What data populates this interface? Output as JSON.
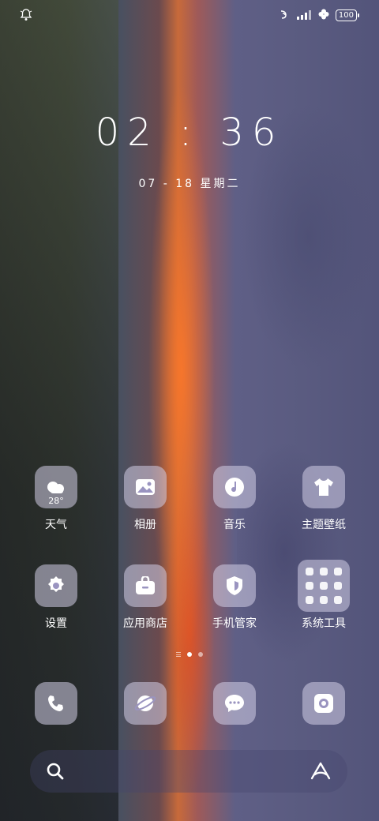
{
  "status": {
    "battery": "100",
    "icons_left": [
      "bell-icon"
    ],
    "icons_right": [
      "nfc-icon",
      "signal-icon",
      "fan-icon",
      "battery-icon"
    ]
  },
  "clock": {
    "time": "02 : 36",
    "date": "07 - 18 星期二"
  },
  "apps_row1": [
    {
      "label": "天气",
      "icon": "weather-icon",
      "extra": "28°"
    },
    {
      "label": "相册",
      "icon": "gallery-icon"
    },
    {
      "label": "音乐",
      "icon": "music-icon"
    },
    {
      "label": "主题壁纸",
      "icon": "theme-icon"
    }
  ],
  "apps_row2": [
    {
      "label": "设置",
      "icon": "settings-icon"
    },
    {
      "label": "应用商店",
      "icon": "app-store-icon"
    },
    {
      "label": "手机管家",
      "icon": "phone-manager-icon"
    },
    {
      "label": "系统工具",
      "icon": "system-tools-folder-icon"
    }
  ],
  "dock": [
    {
      "icon": "phone-icon"
    },
    {
      "icon": "browser-icon"
    },
    {
      "icon": "messages-icon"
    },
    {
      "icon": "camera-icon"
    }
  ],
  "page_indicator": {
    "pages": 2,
    "current": 1
  },
  "search": {
    "left_icon": "search-icon",
    "right_icon": "assistant-icon"
  },
  "colors": {
    "icon_bg": "#d2cde6",
    "glyph": "#ffffff",
    "accent_sunset": "#c86a3a"
  }
}
